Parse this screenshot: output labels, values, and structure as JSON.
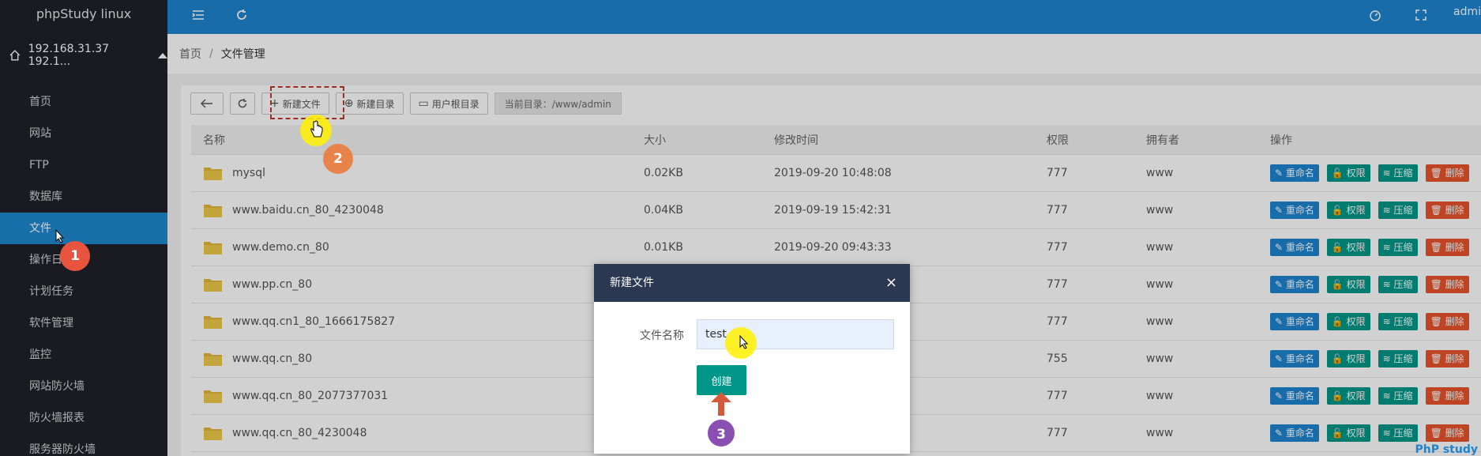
{
  "app": {
    "title": "phpStudy linux",
    "user": "admi"
  },
  "server": {
    "ip": "192.168.31.37 192.1..."
  },
  "nav": {
    "items": [
      {
        "label": "首页"
      },
      {
        "label": "网站"
      },
      {
        "label": "FTP"
      },
      {
        "label": "数据库"
      },
      {
        "label": "文件",
        "active": true
      },
      {
        "label": "操作日"
      },
      {
        "label": "计划任务"
      },
      {
        "label": "软件管理"
      },
      {
        "label": "监控"
      },
      {
        "label": "网站防火墙"
      },
      {
        "label": "防火墙报表"
      },
      {
        "label": "服务器防火墙"
      }
    ]
  },
  "breadcrumb": {
    "home": "首页",
    "sep": "/",
    "current": "文件管理"
  },
  "toolbar": {
    "new_file": "新建文件",
    "new_dir": "新建目录",
    "user_root": "用户根目录",
    "current_dir": "当前目录：/www/admin"
  },
  "table": {
    "headers": [
      "名称",
      "大小",
      "修改时间",
      "权限",
      "拥有者",
      "操作"
    ],
    "rows": [
      {
        "name": "mysql",
        "size": "0.02KB",
        "time": "2019-09-20 10:48:08",
        "perm": "777",
        "owner": "www"
      },
      {
        "name": "www.baidu.cn_80_4230048",
        "size": "0.04KB",
        "time": "2019-09-19 15:42:31",
        "perm": "777",
        "owner": "www"
      },
      {
        "name": "www.demo.cn_80",
        "size": "0.01KB",
        "time": "2019-09-20 09:43:33",
        "perm": "777",
        "owner": "www"
      },
      {
        "name": "www.pp.cn_80",
        "size": "",
        "time": "",
        "perm": "777",
        "owner": "www"
      },
      {
        "name": "www.qq.cn1_80_1666175827",
        "size": "",
        "time": "",
        "perm": "777",
        "owner": "www"
      },
      {
        "name": "www.qq.cn_80",
        "size": "",
        "time": "",
        "perm": "755",
        "owner": "www"
      },
      {
        "name": "www.qq.cn_80_2077377031",
        "size": "",
        "time": "",
        "perm": "777",
        "owner": "www"
      },
      {
        "name": "www.qq.cn_80_4230048",
        "size": "",
        "time": "",
        "perm": "777",
        "owner": "www"
      }
    ],
    "ops": {
      "rename": "重命名",
      "perm": "权限",
      "compress": "压缩",
      "delete": "删除"
    }
  },
  "dialog": {
    "title": "新建文件",
    "close": "×",
    "label": "文件名称",
    "value": "test",
    "create": "创建"
  },
  "annotations": {
    "step1": "1",
    "step2": "2",
    "step3": "3"
  },
  "watermark": "PhP study",
  "colors": {
    "header": "#1e84d0",
    "sidebar": "#20222a",
    "active": "#1e88d0",
    "dialog_head": "#2b3852",
    "create_btn": "#009688"
  }
}
